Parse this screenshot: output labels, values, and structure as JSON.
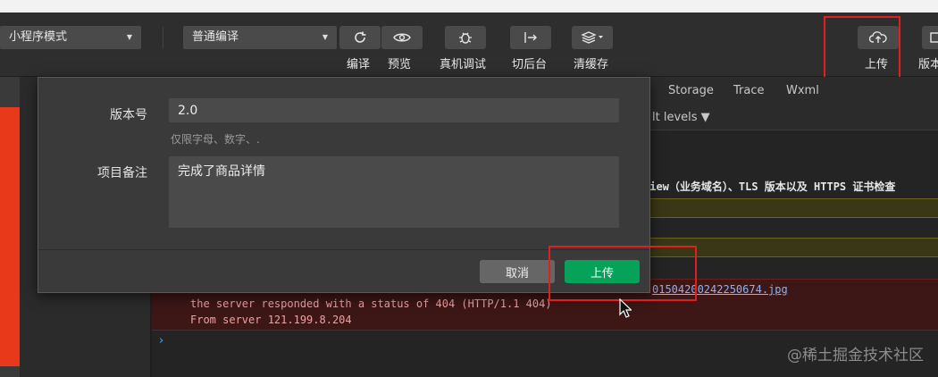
{
  "toolbar": {
    "mode_select": "小程序模式",
    "compile_select": "普通编译",
    "labels": {
      "compile": "编译",
      "preview": "预览",
      "real_debug": "真机调试",
      "background": "切后台",
      "clear_cache": "清缓存",
      "upload": "上传",
      "version": "版本"
    }
  },
  "panel": {
    "tabs": [
      "Storage",
      "Trace",
      "Wxml"
    ],
    "filter": "lt levels ▼"
  },
  "console": {
    "warning_text": "view（业务域名）、TLS 版本以及 HTTPS 证书检查",
    "error_line1": "the server responded with a status of 404 (HTTP/1.1 404)",
    "error_line2": "From server 121.199.8.204",
    "error_url": "015042002422506​74.jpg"
  },
  "dialog": {
    "version_label": "版本号",
    "version_value": "2.0",
    "version_hint": "仅限字母、数字、.",
    "remark_label": "项目备注",
    "remark_value": "完成了商品详情",
    "cancel": "取消",
    "upload": "上传"
  },
  "watermark": "@稀土掘金技术社区",
  "colors": {
    "highlight": "#e02020",
    "primary_button": "#07a25a"
  }
}
